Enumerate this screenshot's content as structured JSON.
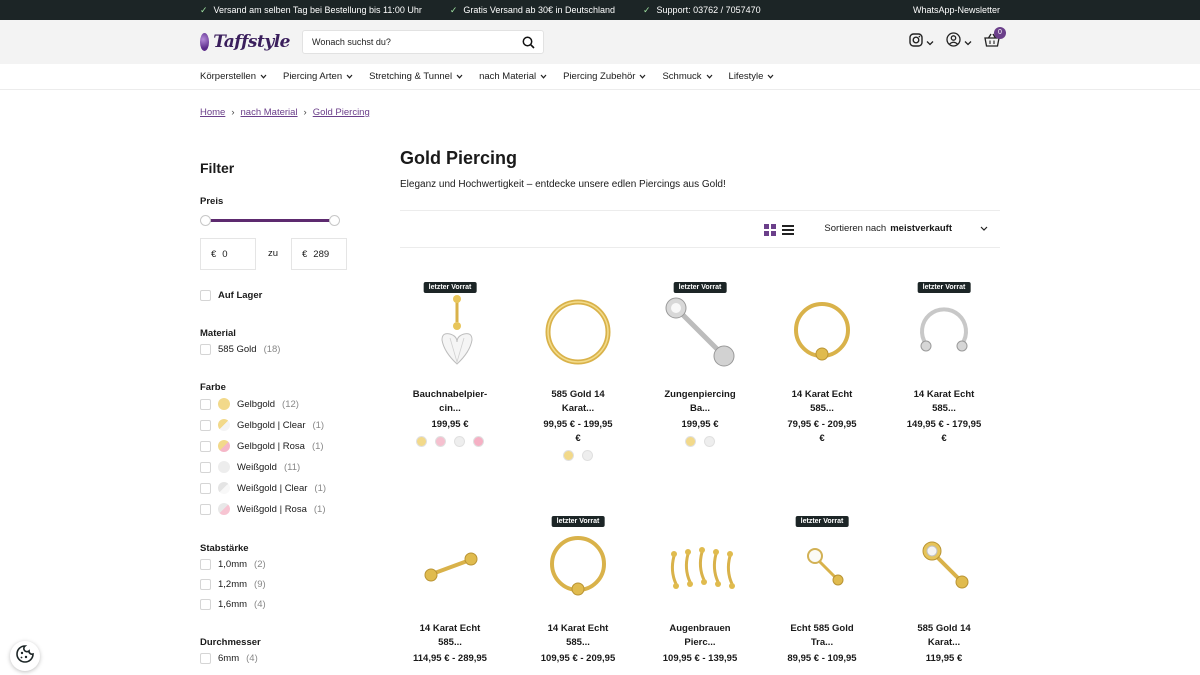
{
  "topbar": {
    "usps": [
      "Versand am selben Tag bei Bestellung bis 11:00 Uhr",
      "Gratis Versand ab 30€ in Deutschland",
      "Support: 03762 / 7057470"
    ],
    "newsletter": "WhatsApp-Newsletter"
  },
  "header": {
    "logo_text": "Taffstyle",
    "search_placeholder": "Wonach suchst du?",
    "cart_count": "0"
  },
  "nav": [
    "Körperstellen",
    "Piercing Arten",
    "Stretching & Tunnel",
    "nach Material",
    "Piercing Zubehör",
    "Schmuck",
    "Lifestyle"
  ],
  "breadcrumb": [
    "Home",
    "nach Material",
    "Gold Piercing"
  ],
  "sidebar": {
    "title": "Filter",
    "price": {
      "title": "Preis",
      "currency": "€",
      "min": "0",
      "max": "289",
      "to_label": "zu"
    },
    "stock_label": "Auf Lager",
    "material": {
      "title": "Material",
      "items": [
        {
          "label": "585 Gold",
          "count": "(18)"
        }
      ]
    },
    "farbe": {
      "title": "Farbe",
      "items": [
        {
          "label": "Gelbgold",
          "count": "(12)"
        },
        {
          "label": "Gelbgold | Clear",
          "count": "(1)"
        },
        {
          "label": "Gelbgold | Rosa",
          "count": "(1)"
        },
        {
          "label": "Weißgold",
          "count": "(11)"
        },
        {
          "label": "Weißgold | Clear",
          "count": "(1)"
        },
        {
          "label": "Weißgold | Rosa",
          "count": "(1)"
        }
      ]
    },
    "stab": {
      "title": "Stabstärke",
      "items": [
        {
          "label": "1,0mm",
          "count": "(2)"
        },
        {
          "label": "1,2mm",
          "count": "(9)"
        },
        {
          "label": "1,6mm",
          "count": "(4)"
        }
      ]
    },
    "durchmesser": {
      "title": "Durchmesser",
      "items": [
        {
          "label": "6mm",
          "count": "(4)"
        }
      ]
    }
  },
  "main": {
    "title": "Gold Piercing",
    "intro": "Eleganz und Hochwertigkeit – entdecke unsere edlen Piercings aus Gold!",
    "sort_label": "Sortieren nach",
    "sort_value": "meistverkauft"
  },
  "products": [
    {
      "tag": "letzter Vorrat",
      "name1": "Bauchnabelpier-",
      "name2": "cin...",
      "price1": "199,95 €",
      "price2": ""
    },
    {
      "tag": "",
      "name1": "585 Gold 14",
      "name2": "Karat...",
      "price1": "99,95 € - 199,95",
      "price2": "€"
    },
    {
      "tag": "letzter Vorrat",
      "name1": "Zungenpiercing",
      "name2": "Ba...",
      "price1": "199,95 €",
      "price2": ""
    },
    {
      "tag": "",
      "name1": "14 Karat Echt",
      "name2": "585...",
      "price1": "79,95 € - 209,95",
      "price2": "€"
    },
    {
      "tag": "letzter Vorrat",
      "name1": "14 Karat Echt",
      "name2": "585...",
      "price1": "149,95 € - 179,95",
      "price2": "€"
    },
    {
      "tag": "",
      "name1": "14 Karat Echt",
      "name2": "585...",
      "price1": "114,95 € - 289,95",
      "price2": ""
    },
    {
      "tag": "letzter Vorrat",
      "name1": "14 Karat Echt",
      "name2": "585...",
      "price1": "109,95 € - 209,95",
      "price2": ""
    },
    {
      "tag": "",
      "name1": "Augenbrauen",
      "name2": "Pierc...",
      "price1": "109,95 € - 139,95",
      "price2": ""
    },
    {
      "tag": "letzter Vorrat",
      "name1": "Echt 585 Gold",
      "name2": "Tra...",
      "price1": "89,95 € - 109,95",
      "price2": ""
    },
    {
      "tag": "",
      "name1": "585 Gold 14",
      "name2": "Karat...",
      "price1": "119,95 €",
      "price2": ""
    }
  ],
  "colors": {
    "accent": "#6b3f8a",
    "topbar": "#1c2526",
    "gold": "#e8c55a",
    "slider": "#5d2a6f"
  }
}
